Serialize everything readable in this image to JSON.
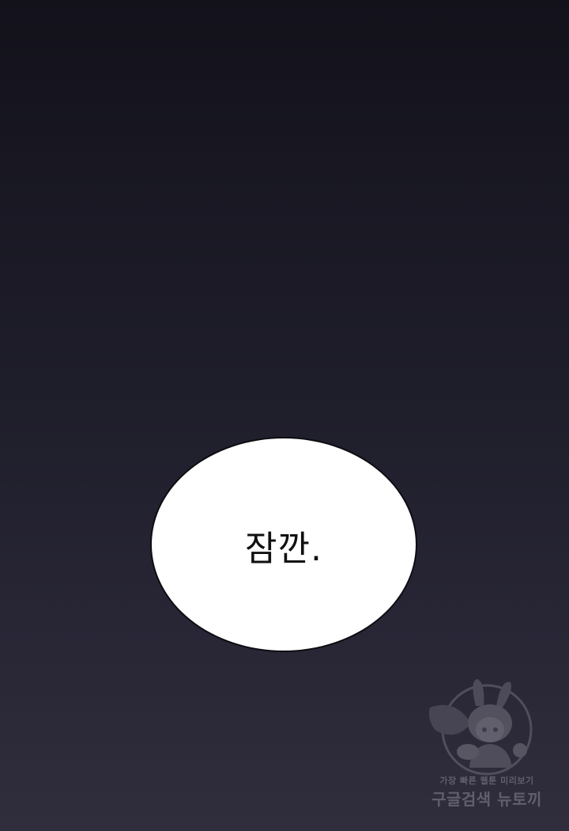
{
  "dialogue": {
    "text": "잠깐."
  },
  "watermark": {
    "tagline": "가장 빠른 웹툰 미리보기",
    "brand": "구글검색 뉴토끼",
    "icon": "rabbit-girl-mascot-icon"
  },
  "colors": {
    "background_top": "#13121b",
    "background_bottom": "#302d3c",
    "bubble_fill": "#ffffff",
    "bubble_outline": "#0d0d12",
    "watermark_gray": "#8a8896"
  }
}
